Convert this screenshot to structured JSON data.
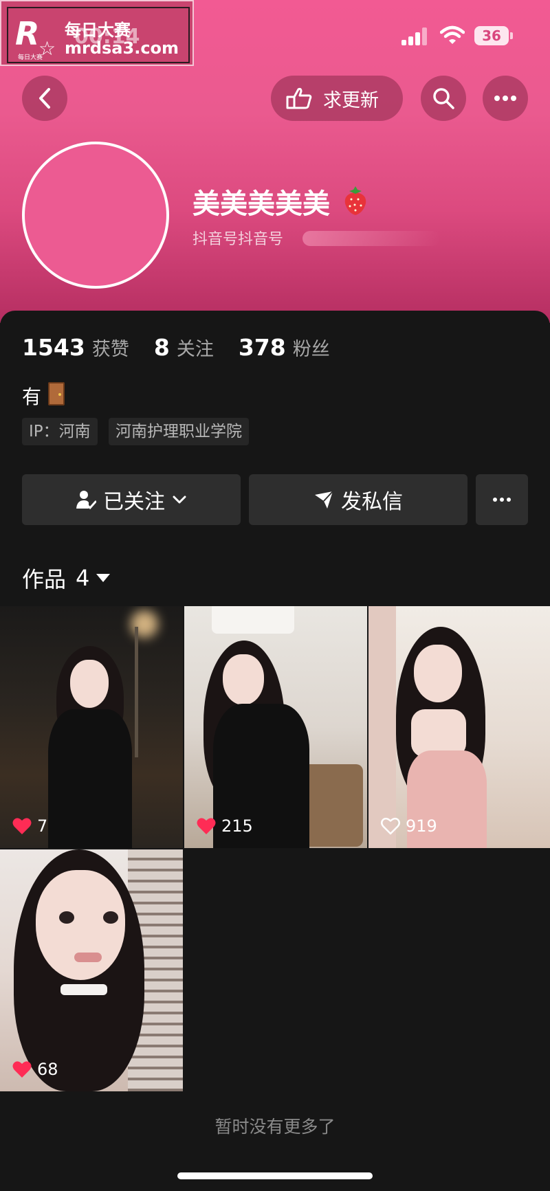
{
  "watermark": {
    "logo": "R",
    "star": "☆",
    "subtitle": "每日大赛",
    "title": "每日大赛",
    "url": "mrdsa3.com"
  },
  "status_bar": {
    "time": "00:14",
    "battery": "36"
  },
  "top_nav": {
    "back_icon": "chevron-left-icon",
    "update_label": "求更新",
    "update_icon": "pointing-hand-icon",
    "search_icon": "search-icon",
    "more_icon": "more-dots-icon"
  },
  "profile": {
    "name": "美美美美美",
    "name_emoji_icon": "strawberry-icon",
    "handle": "抖音号抖音号"
  },
  "stats": [
    {
      "value": "1543",
      "label": "获赞"
    },
    {
      "value": "8",
      "label": "关注"
    },
    {
      "value": "378",
      "label": "粉丝"
    }
  ],
  "bio": {
    "text": "有",
    "emoji_icon": "door-icon"
  },
  "tags": {
    "ip": "IP：河南",
    "school": "河南护理职业学院"
  },
  "actions": {
    "follow_label": "已关注",
    "message_label": "发私信",
    "more_icon": "more-dots-icon"
  },
  "works": {
    "label": "作品",
    "count": "4",
    "items": [
      {
        "likes": "7",
        "liked": true
      },
      {
        "likes": "215",
        "liked": true
      },
      {
        "likes": "919",
        "liked": false
      },
      {
        "likes": "68",
        "liked": true
      }
    ]
  },
  "footer": {
    "end_text": "暂时没有更多了"
  },
  "colors": {
    "header_pink": "#ea5a8f",
    "panel_dark": "#161616",
    "like_red": "#fe2c55"
  }
}
